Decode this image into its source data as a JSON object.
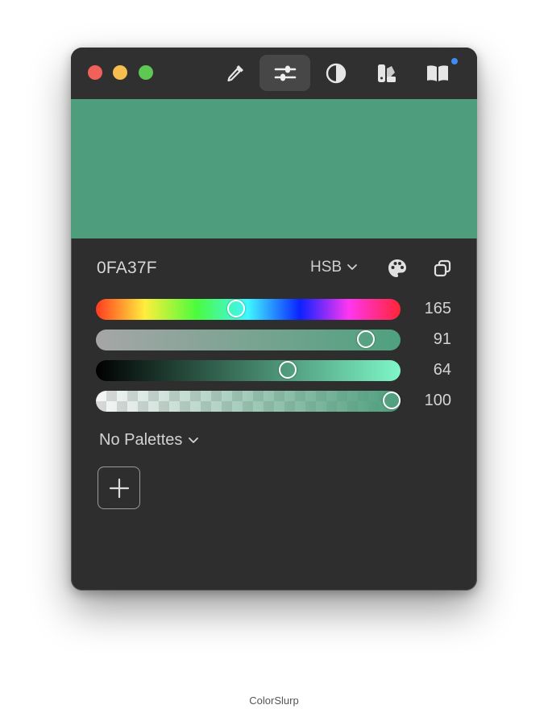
{
  "window": {
    "traffic_lights": [
      "close",
      "minimize",
      "zoom"
    ],
    "toolbar": [
      {
        "icon": "eyedropper-icon",
        "active": false
      },
      {
        "icon": "sliders-icon",
        "active": true
      },
      {
        "icon": "contrast-icon",
        "active": false
      },
      {
        "icon": "color-swatches-icon",
        "active": false
      },
      {
        "icon": "book-icon",
        "active": false,
        "badge": true
      }
    ],
    "preview_color": "#4E9E7D"
  },
  "color": {
    "hex": "0FA37F",
    "model": "HSB",
    "sliders": [
      {
        "name": "hue",
        "value": "165",
        "fraction": 0.46
      },
      {
        "name": "saturation",
        "value": "91",
        "fraction": 0.885
      },
      {
        "name": "brightness",
        "value": "64",
        "fraction": 0.63
      },
      {
        "name": "alpha",
        "value": "100",
        "fraction": 0.97
      }
    ]
  },
  "palettes": {
    "label": "No Palettes"
  },
  "caption": "ColorSlurp"
}
